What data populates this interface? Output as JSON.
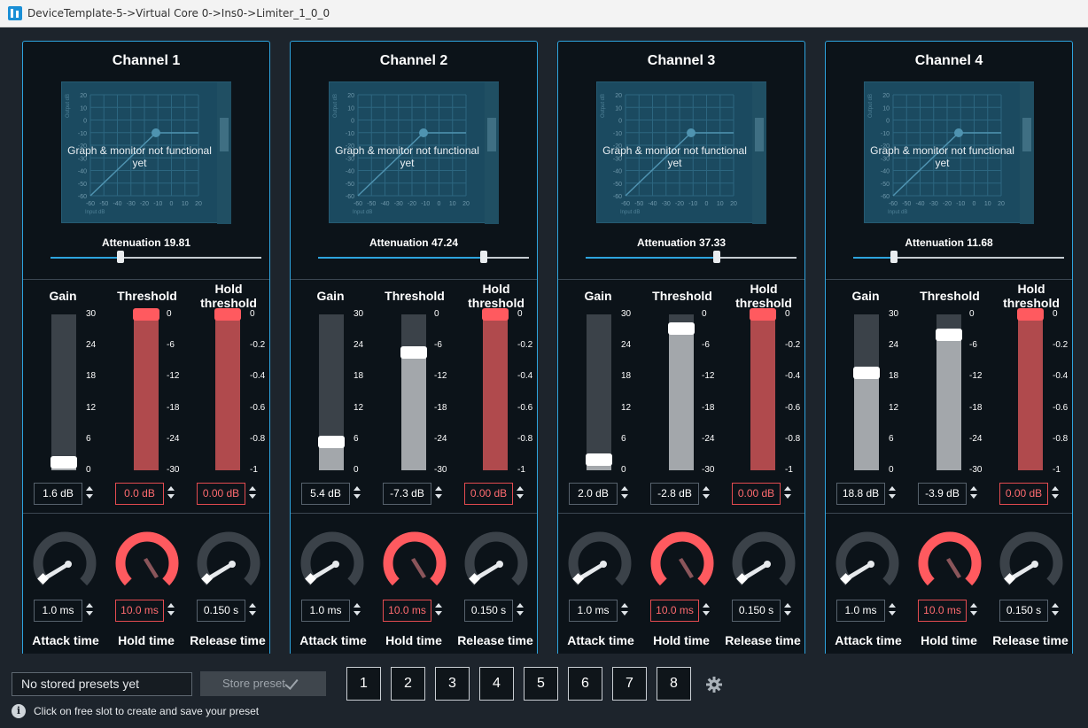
{
  "window": {
    "title": "DeviceTemplate-5->Virtual Core 0->Ins0->Limiter_1_0_0"
  },
  "graph": {
    "message": "Graph & monitor not functional yet",
    "y_ticks": [
      "20",
      "10",
      "0",
      "-10",
      "-20",
      "-30",
      "-40",
      "-50",
      "-60"
    ],
    "x_ticks": [
      "-60",
      "-50",
      "-40",
      "-30",
      "-20",
      "-10",
      "0",
      "10",
      "20"
    ],
    "ylabel": "Output dB",
    "xlabel": "Input dB"
  },
  "labels": {
    "gain": "Gain",
    "threshold": "Threshold",
    "hold_threshold": "Hold threshold",
    "attack_time": "Attack time",
    "hold_time": "Hold time",
    "release_time": "Release time"
  },
  "scales": {
    "gain": [
      "30",
      "24",
      "18",
      "12",
      "6",
      "0"
    ],
    "threshold": [
      "0",
      "-6",
      "-12",
      "-18",
      "-24",
      "-30"
    ],
    "hold": [
      "0",
      "-0.2",
      "-0.4",
      "-0.6",
      "-0.8",
      "-1"
    ]
  },
  "colors": {
    "accent": "#2ea4de",
    "alert": "#ff5a5f",
    "panel": "#0c1319"
  },
  "channels": [
    {
      "title": "Channel 1",
      "attenuation_label": "Attenuation 19.81",
      "attenuation": 19.81,
      "gain": "1.6 dB",
      "gain_val": 1.6,
      "threshold": "0.0 dB",
      "threshold_val": 0.0,
      "hold_threshold": "0.00 dB",
      "hold_threshold_val": 0.0,
      "attack": "1.0 ms",
      "hold": "10.0 ms",
      "release": "0.150 s"
    },
    {
      "title": "Channel 2",
      "attenuation_label": "Attenuation 47.24",
      "attenuation": 47.24,
      "gain": "5.4 dB",
      "gain_val": 5.4,
      "threshold": "-7.3 dB",
      "threshold_val": -7.3,
      "hold_threshold": "0.00 dB",
      "hold_threshold_val": 0.0,
      "attack": "1.0 ms",
      "hold": "10.0 ms",
      "release": "0.150 s"
    },
    {
      "title": "Channel 3",
      "attenuation_label": "Attenuation 37.33",
      "attenuation": 37.33,
      "gain": "2.0 dB",
      "gain_val": 2.0,
      "threshold": "-2.8 dB",
      "threshold_val": -2.8,
      "hold_threshold": "0.00 dB",
      "hold_threshold_val": 0.0,
      "attack": "1.0 ms",
      "hold": "10.0 ms",
      "release": "0.150 s"
    },
    {
      "title": "Channel 4",
      "attenuation_label": "Attenuation 11.68",
      "attenuation": 11.68,
      "gain": "18.8 dB",
      "gain_val": 18.8,
      "threshold": "-3.9 dB",
      "threshold_val": -3.9,
      "hold_threshold": "0.00 dB",
      "hold_threshold_val": 0.0,
      "attack": "1.0 ms",
      "hold": "10.0 ms",
      "release": "0.150 s"
    }
  ],
  "presets": {
    "field": "No stored presets yet",
    "store_label": "Store preset",
    "slots": [
      "1",
      "2",
      "3",
      "4",
      "5",
      "6",
      "7",
      "8"
    ],
    "info": "Click on free slot to create and save your preset"
  }
}
